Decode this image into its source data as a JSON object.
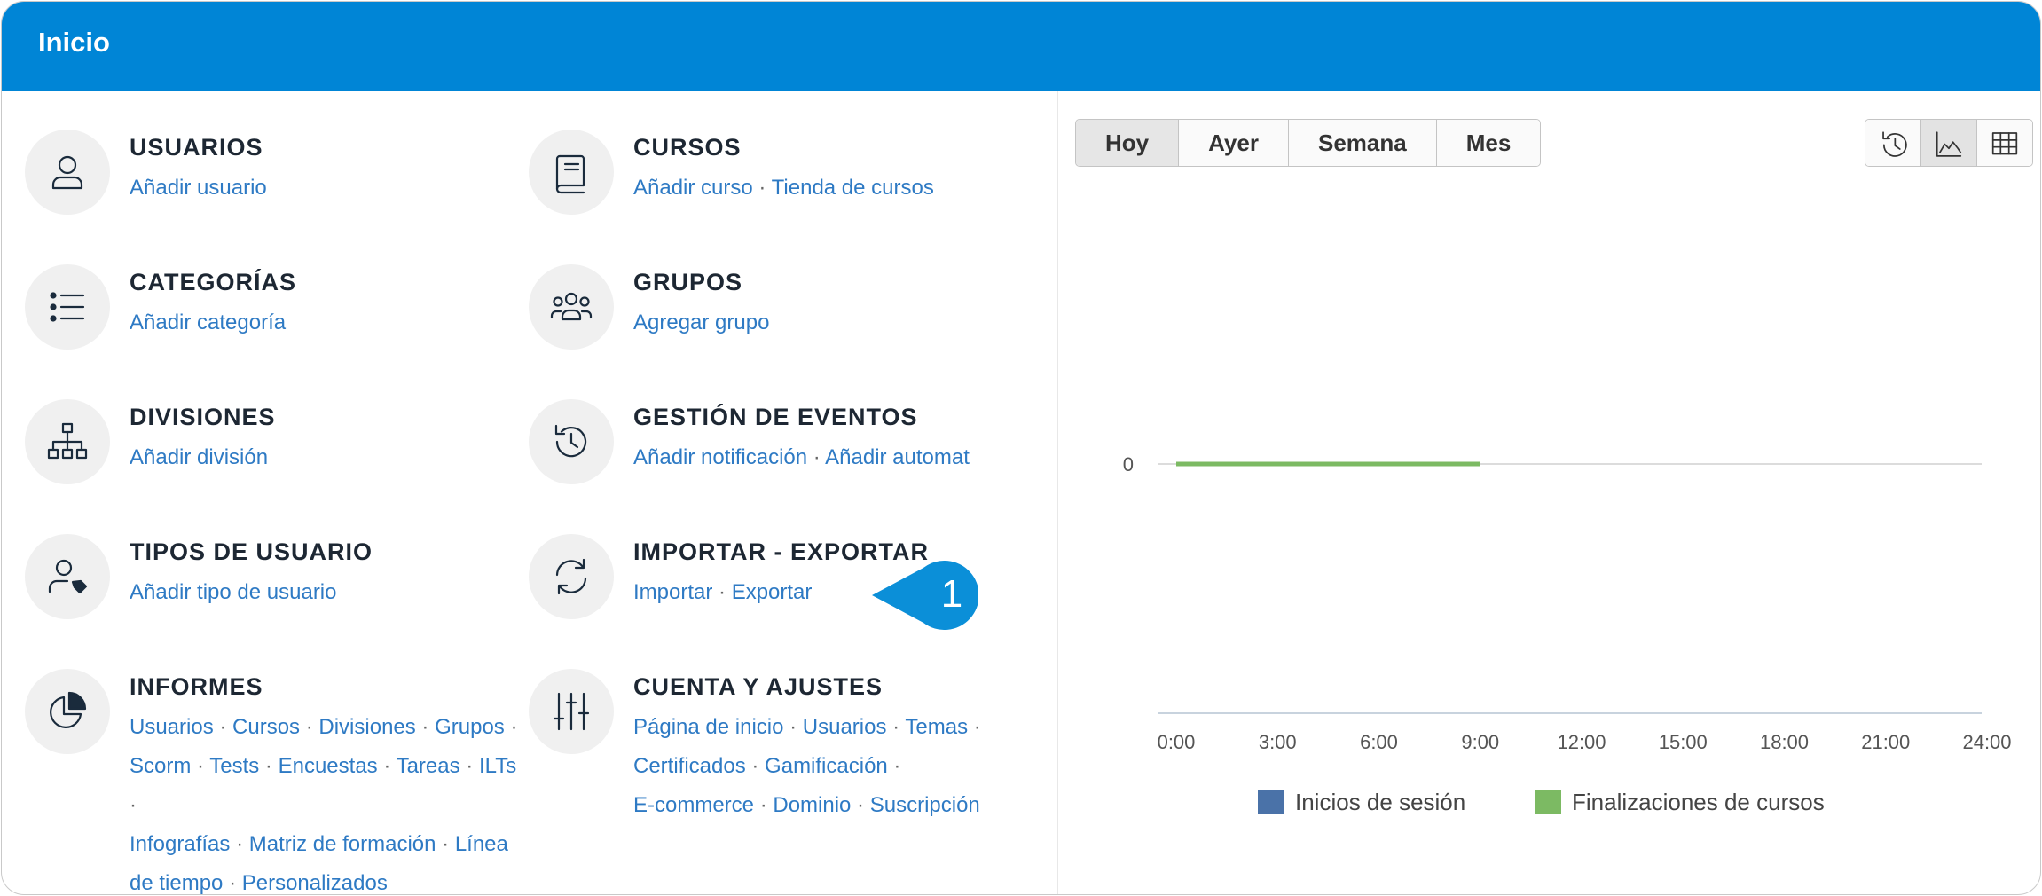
{
  "header": {
    "title": "Inicio"
  },
  "modules": {
    "usuarios": {
      "title": "USUARIOS",
      "icon": "user-icon",
      "links": [
        "Añadir usuario"
      ]
    },
    "cursos": {
      "title": "CURSOS",
      "icon": "book-icon",
      "links": [
        "Añadir curso",
        "Tienda de cursos"
      ]
    },
    "categorias": {
      "title": "CATEGORÍAS",
      "icon": "list-icon",
      "links": [
        "Añadir categoría"
      ]
    },
    "grupos": {
      "title": "GRUPOS",
      "icon": "group-icon",
      "links": [
        "Agregar grupo"
      ]
    },
    "divisiones": {
      "title": "DIVISIONES",
      "icon": "hierarchy-icon",
      "links": [
        "Añadir división"
      ]
    },
    "eventos": {
      "title": "GESTIÓN DE EVENTOS",
      "icon": "history-icon",
      "links": [
        "Añadir notificación",
        "Añadir automat"
      ]
    },
    "tipos": {
      "title": "TIPOS DE USUARIO",
      "icon": "user-tag-icon",
      "links": [
        "Añadir tipo de usuario"
      ]
    },
    "importar": {
      "title": "IMPORTAR - EXPORTAR",
      "icon": "sync-icon",
      "links": [
        "Importar",
        "Exportar"
      ]
    },
    "informes": {
      "title": "INFORMES",
      "icon": "pie-chart-icon",
      "links": [
        "Usuarios",
        "Cursos",
        "Divisiones",
        "Grupos",
        "Scorm",
        "Tests",
        "Encuestas",
        "Tareas",
        "ILTs",
        "Infografías",
        "Matriz de formación",
        "Línea de tiempo",
        "Personalizados"
      ]
    },
    "cuenta": {
      "title": "CUENTA Y AJUSTES",
      "icon": "sliders-icon",
      "links": [
        "Página de inicio",
        "Usuarios",
        "Temas",
        "Certificados",
        "Gamificación",
        "E-commerce",
        "Dominio",
        "Suscripción"
      ]
    }
  },
  "period_tabs": [
    "Hoy",
    "Ayer",
    "Semana",
    "Mes"
  ],
  "active_period": "Hoy",
  "view_buttons": [
    "history-icon",
    "area-chart-icon",
    "table-icon"
  ],
  "active_view": "area-chart-icon",
  "callout": {
    "number": "1",
    "color": "#0b8fd8"
  },
  "colors": {
    "header": "#0085d6",
    "link": "#2e7ac4",
    "series_logins": "#4a72a8",
    "series_completions": "#7cba63"
  },
  "chart_data": {
    "type": "line",
    "title": "",
    "x": [
      "0:00",
      "3:00",
      "6:00",
      "9:00",
      "12:00",
      "15:00",
      "18:00",
      "21:00",
      "24:00"
    ],
    "y_ticks": [
      0
    ],
    "series": [
      {
        "name": "Inicios de sesión",
        "color": "#4a72a8",
        "x_start": "0:00",
        "x_end": "9:00",
        "values": [
          0,
          0,
          0,
          0
        ]
      },
      {
        "name": "Finalizaciones de cursos",
        "color": "#7cba63",
        "x_start": "0:00",
        "x_end": "9:00",
        "values": [
          0,
          0,
          0,
          0
        ]
      }
    ],
    "legend_position": "bottom",
    "grid": true
  }
}
